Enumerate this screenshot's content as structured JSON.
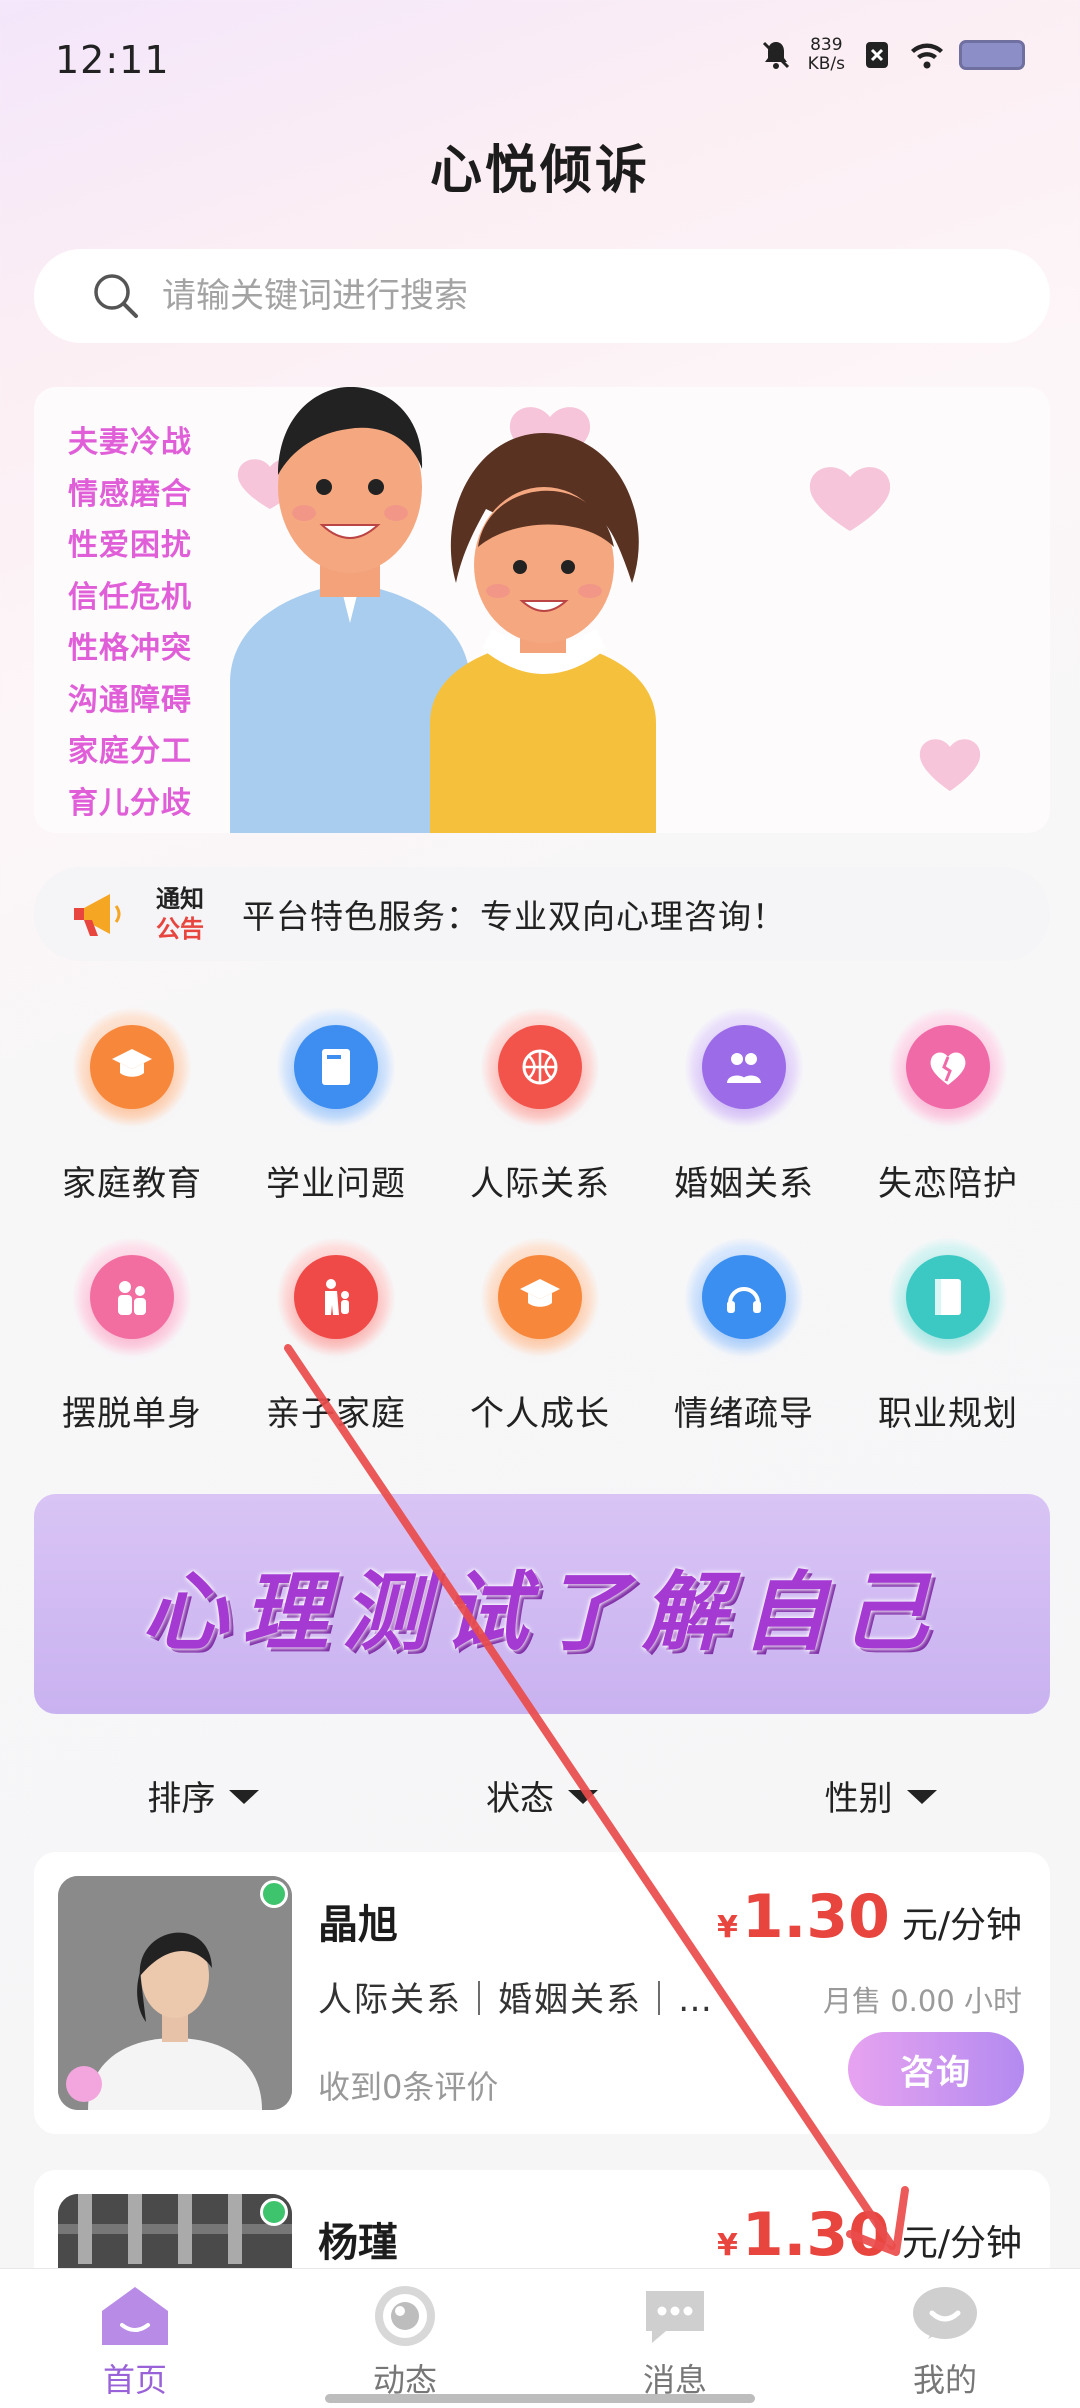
{
  "status_bar": {
    "time": "12:11",
    "net_speed_value": "839",
    "net_speed_unit": "KB/s"
  },
  "header": {
    "title": "心悦倾诉"
  },
  "search": {
    "placeholder": "请输关键词进行搜索"
  },
  "banner": {
    "tags": [
      "夫妻冷战",
      "情感磨合",
      "性爱困扰",
      "信任危机",
      "性格冲突",
      "沟通障碍",
      "家庭分工",
      "育儿分歧"
    ]
  },
  "notice": {
    "tag_line1": "通知",
    "tag_line2": "公告",
    "text": "平台特色服务：专业双向心理咨询！"
  },
  "categories": [
    {
      "label": "家庭教育",
      "icon": "graduation-cap-icon",
      "color": "#f7873b"
    },
    {
      "label": "学业问题",
      "icon": "book-icon",
      "color": "#3d8ef0"
    },
    {
      "label": "人际关系",
      "icon": "basketball-icon",
      "color": "#f2544c"
    },
    {
      "label": "婚姻关系",
      "icon": "couple-icon",
      "color": "#9b6be8"
    },
    {
      "label": "失恋陪护",
      "icon": "broken-heart-icon",
      "color": "#f06aa8"
    },
    {
      "label": "摆脱单身",
      "icon": "people-icon",
      "color": "#f36ea0"
    },
    {
      "label": "亲子家庭",
      "icon": "parent-child-icon",
      "color": "#ef4a48"
    },
    {
      "label": "个人成长",
      "icon": "graduation-cap-icon",
      "color": "#f7873b"
    },
    {
      "label": "情绪疏导",
      "icon": "headphones-icon",
      "color": "#3b8ff0"
    },
    {
      "label": "职业规划",
      "icon": "notebook-icon",
      "color": "#3cc9c4"
    }
  ],
  "test_banner": {
    "text": "心理测试了解自己"
  },
  "filters": [
    "排序",
    "状态",
    "性别"
  ],
  "counselors": [
    {
      "name": "晶旭",
      "currency": "¥",
      "price": "1.30",
      "unit": "元/分钟",
      "tags": "人际关系｜婚姻关系｜…",
      "sales": "月售 0.00 小时",
      "reviews": "收到0条评价",
      "consult_label": "咨询",
      "online": true
    },
    {
      "name": "杨瑾",
      "currency": "¥",
      "price": "1.30",
      "unit": "元/分钟",
      "online": true
    }
  ],
  "bottom_nav": [
    {
      "label": "首页",
      "icon": "home-icon",
      "active": true
    },
    {
      "label": "动态",
      "icon": "moments-icon",
      "active": false
    },
    {
      "label": "消息",
      "icon": "message-icon",
      "active": false
    },
    {
      "label": "我的",
      "icon": "profile-icon",
      "active": false
    }
  ],
  "colors": {
    "accent": "#9a62d8",
    "price": "#e8453f",
    "banner_tag": "#e05fd8",
    "online": "#3ec46d",
    "annotation_arrow": "#ea4c4c"
  }
}
